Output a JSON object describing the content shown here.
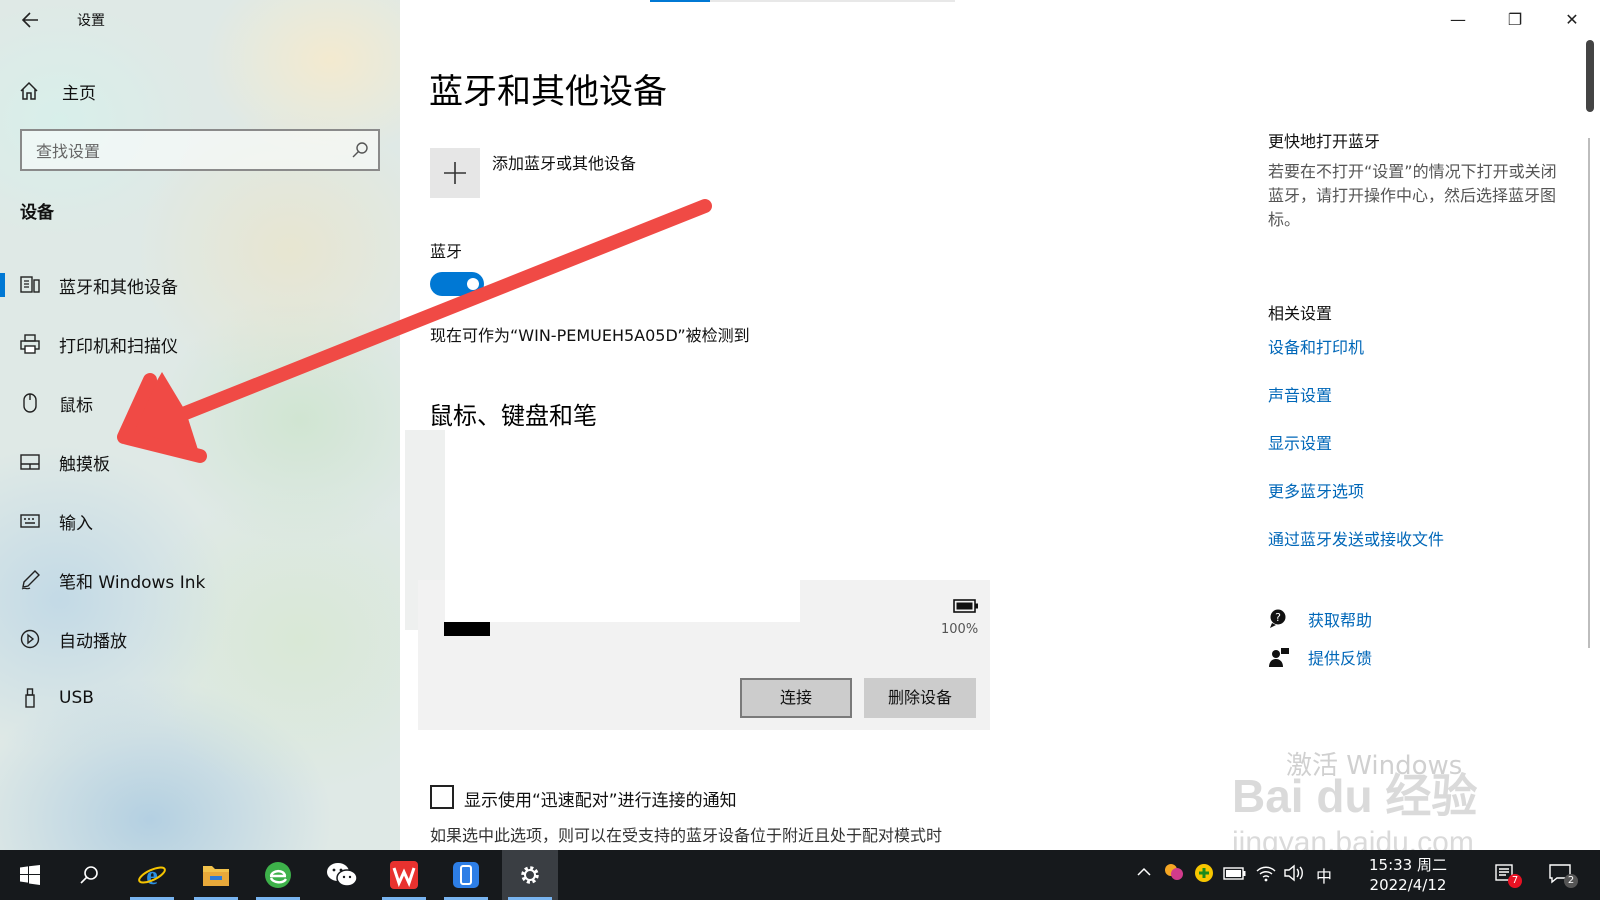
{
  "window": {
    "title": "设置",
    "back_icon": "back-arrow-icon",
    "minimize": "—",
    "restore": "❐",
    "close": "✕"
  },
  "sidebar": {
    "home_label": "主页",
    "search_placeholder": "查找设置",
    "section_label": "设备",
    "items": [
      {
        "label": "蓝牙和其他设备",
        "icon": "bluetooth-devices-icon",
        "active": true
      },
      {
        "label": "打印机和扫描仪",
        "icon": "printer-icon"
      },
      {
        "label": "鼠标",
        "icon": "mouse-icon"
      },
      {
        "label": "触摸板",
        "icon": "touchpad-icon"
      },
      {
        "label": "输入",
        "icon": "keyboard-icon"
      },
      {
        "label": "笔和 Windows Ink",
        "icon": "pen-icon"
      },
      {
        "label": "自动播放",
        "icon": "autoplay-icon"
      },
      {
        "label": "USB",
        "icon": "usb-icon"
      }
    ]
  },
  "main": {
    "title": "蓝牙和其他设备",
    "add_device_label": "添加蓝牙或其他设备",
    "bluetooth_label": "蓝牙",
    "bluetooth_on": true,
    "discoverable_text": "现在可作为“WIN-PEMUEH5A05D”被检测到",
    "section_mouse_keyboard_pen": "鼠标、键盘和笔",
    "device_card": {
      "battery_percent": "100%",
      "connect_label": "连接",
      "remove_label": "删除设备"
    },
    "swift_pair_label": "显示使用“迅速配对”进行连接的通知",
    "swift_pair_checked": false,
    "swift_pair_desc": "如果选中此选项，则可以在受支持的蓝牙设备位于附近且处于配对模式时"
  },
  "right_panel": {
    "quick_heading": "更快地打开蓝牙",
    "quick_text": "若要在不打开“设置”的情况下打开或关闭蓝牙，请打开操作中心，然后选择蓝牙图标。",
    "related_heading": "相关设置",
    "links": [
      "设备和打印机",
      "声音设置",
      "显示设置",
      "更多蓝牙选项",
      "通过蓝牙发送或接收文件"
    ],
    "help_label": "获取帮助",
    "feedback_label": "提供反馈"
  },
  "watermark": {
    "activate": "激活 Windows",
    "brand": "Bai du 经验",
    "url": "jingyan.baidu.com"
  },
  "taskbar": {
    "tray_ime": "中",
    "clock_time": "15:33 周二",
    "clock_date": "2022/4/12",
    "notification_count": "7",
    "action_center_count": "2"
  },
  "colors": {
    "accent": "#0078d4",
    "link": "#0067b8",
    "annotation_arrow": "#f04a45",
    "taskbar": "#16191c"
  }
}
